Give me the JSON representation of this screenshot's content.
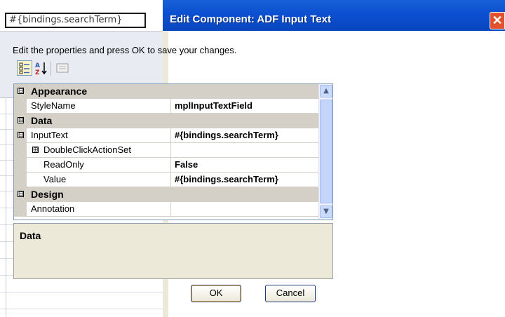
{
  "background": {
    "input_value": "#{bindings.searchTerm}"
  },
  "dialog": {
    "title": "Edit Component: ADF Input Text",
    "close_icon": "close-icon",
    "instructions": "Edit the properties and press OK to save your changes.",
    "toolbar": {
      "categorized_icon": "categorized-view-icon",
      "alphabetical_icon": "alphabetical-sort-icon",
      "property_pages_icon": "property-pages-icon"
    },
    "property_grid": {
      "appearance": {
        "label": "Appearance",
        "expander": "⊟",
        "stylename": {
          "name": "StyleName",
          "value": "mplInputTextField"
        }
      },
      "data": {
        "label": "Data",
        "expander": "⊟",
        "inputtext": {
          "expander": "⊟",
          "name": "InputText",
          "value": "#{bindings.searchTerm}"
        },
        "doubleclick": {
          "expander": "⊞",
          "name": "DoubleClickActionSet",
          "value": ""
        },
        "readonly": {
          "name": "ReadOnly",
          "value": "False"
        },
        "value": {
          "name": "Value",
          "value": "#{bindings.searchTerm}"
        }
      },
      "design": {
        "label": "Design",
        "expander": "⊟",
        "annotation": {
          "name": "Annotation",
          "value": ""
        }
      }
    },
    "description": {
      "title": "Data"
    },
    "buttons": {
      "ok": "OK",
      "cancel": "Cancel"
    }
  }
}
